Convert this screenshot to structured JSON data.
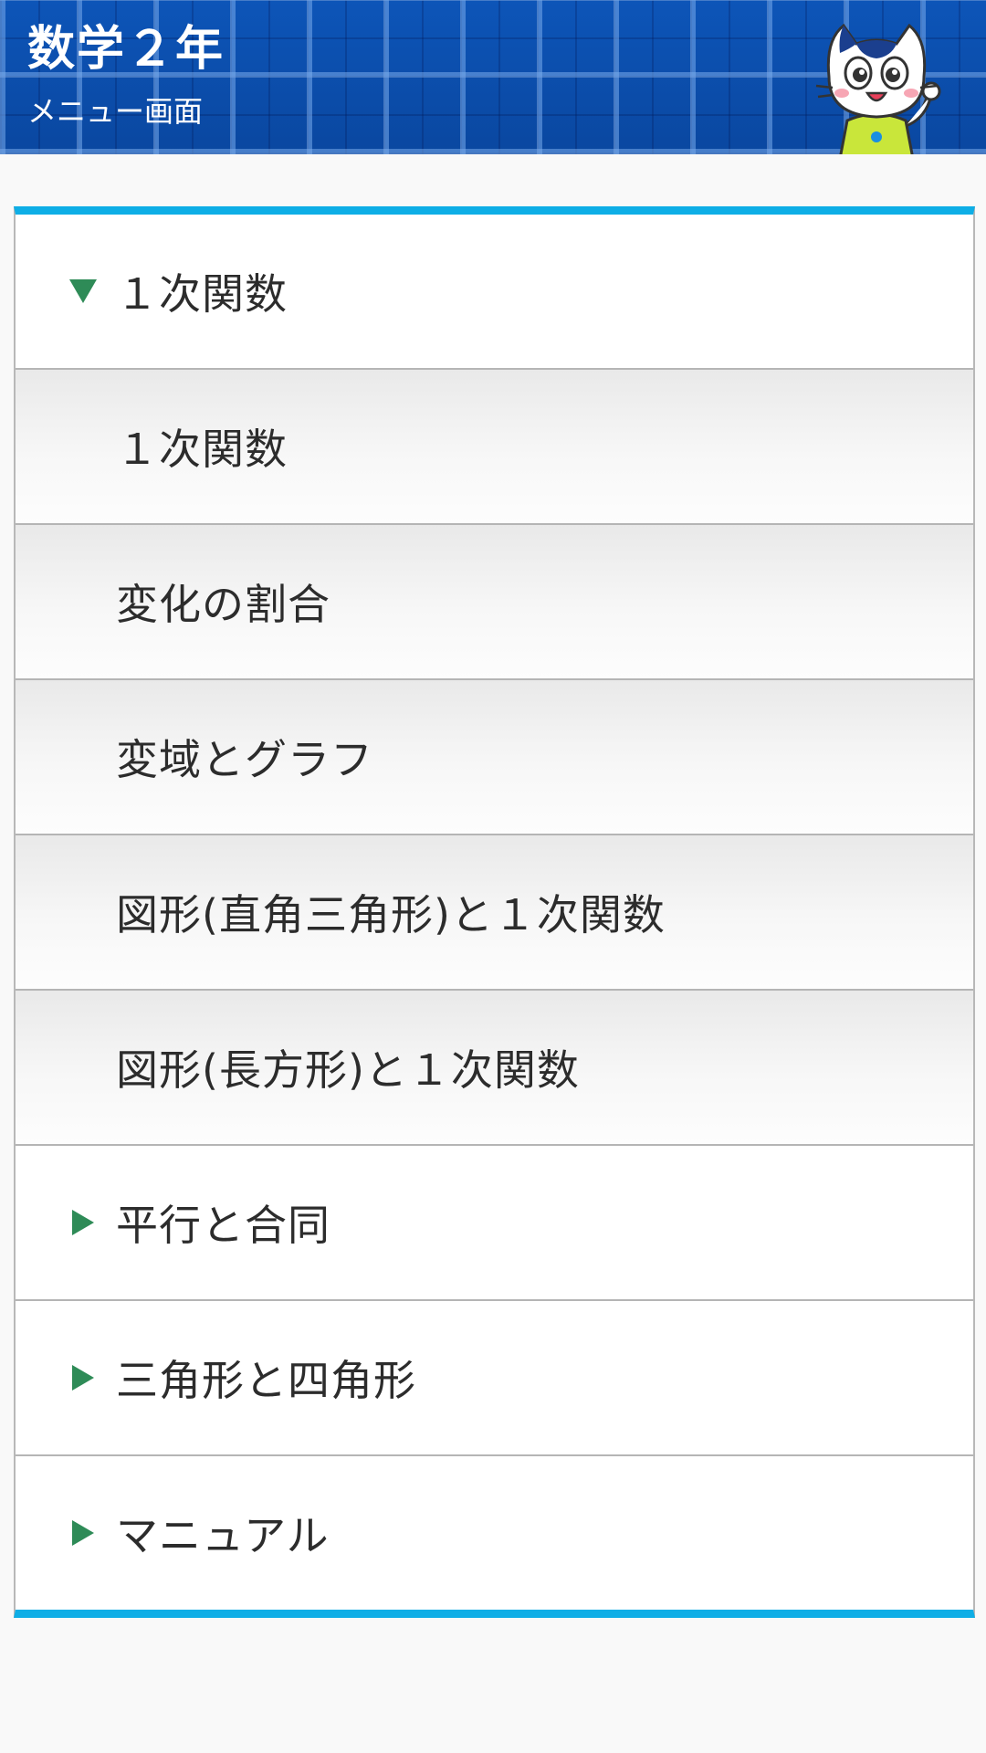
{
  "header": {
    "title": "数学２年",
    "subtitle": "メニュー画面",
    "mascot_icon": "cat-mascot-icon"
  },
  "colors": {
    "accent": "#0eaee6",
    "header_blue": "#0a4aa6",
    "arrow_green": "#2e8b57"
  },
  "menu": {
    "items": [
      {
        "type": "category",
        "label": "１次関数",
        "expanded": true,
        "icon": "triangle-down-icon"
      },
      {
        "type": "sub",
        "label": "１次関数"
      },
      {
        "type": "sub",
        "label": "変化の割合"
      },
      {
        "type": "sub",
        "label": "変域とグラフ"
      },
      {
        "type": "sub",
        "label": "図形(直角三角形)と１次関数"
      },
      {
        "type": "sub",
        "label": "図形(長方形)と１次関数"
      },
      {
        "type": "category",
        "label": "平行と合同",
        "expanded": false,
        "icon": "triangle-right-icon"
      },
      {
        "type": "category",
        "label": "三角形と四角形",
        "expanded": false,
        "icon": "triangle-right-icon"
      },
      {
        "type": "category",
        "label": "マニュアル",
        "expanded": false,
        "icon": "triangle-right-icon"
      }
    ]
  }
}
